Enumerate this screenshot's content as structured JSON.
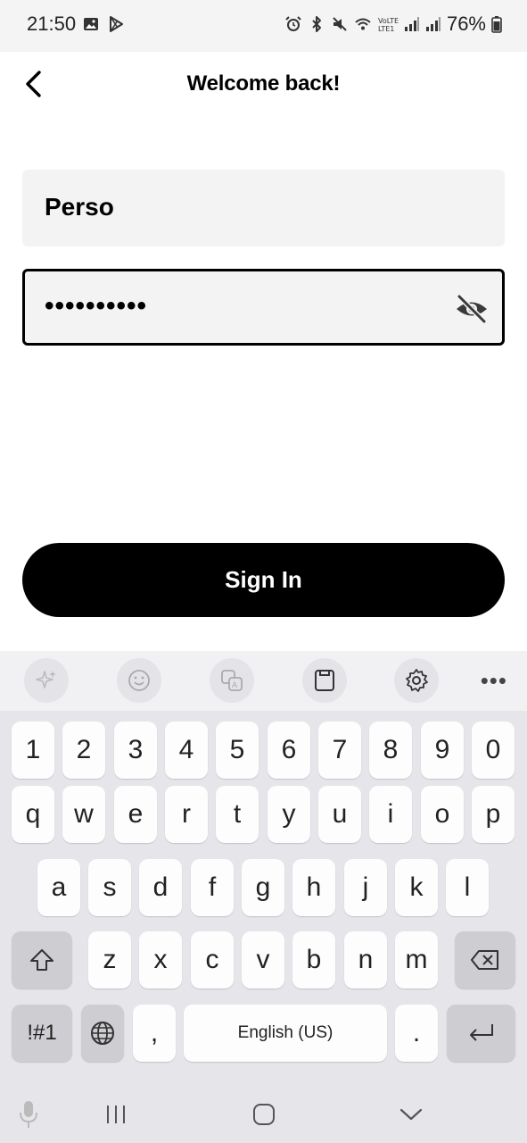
{
  "status_bar": {
    "time": "21:50",
    "battery": "76%"
  },
  "header": {
    "title": "Welcome back!"
  },
  "form": {
    "username_value": "Perso",
    "password_value": "••••••••••"
  },
  "actions": {
    "sign_in_label": "Sign In"
  },
  "keyboard": {
    "row_numbers": [
      "1",
      "2",
      "3",
      "4",
      "5",
      "6",
      "7",
      "8",
      "9",
      "0"
    ],
    "row_top": [
      "q",
      "w",
      "e",
      "r",
      "t",
      "y",
      "u",
      "i",
      "o",
      "p"
    ],
    "row_middle": [
      "a",
      "s",
      "d",
      "f",
      "g",
      "h",
      "j",
      "k",
      "l"
    ],
    "row_bottom": [
      "z",
      "x",
      "c",
      "v",
      "b",
      "n",
      "m"
    ],
    "symbols_label": "!#1",
    "comma": ",",
    "space_label": "English (US)",
    "period": "."
  },
  "colors": {
    "primary": "#000000",
    "field_bg": "#f3f3f3",
    "keyboard_bg": "#e6e6ea"
  }
}
